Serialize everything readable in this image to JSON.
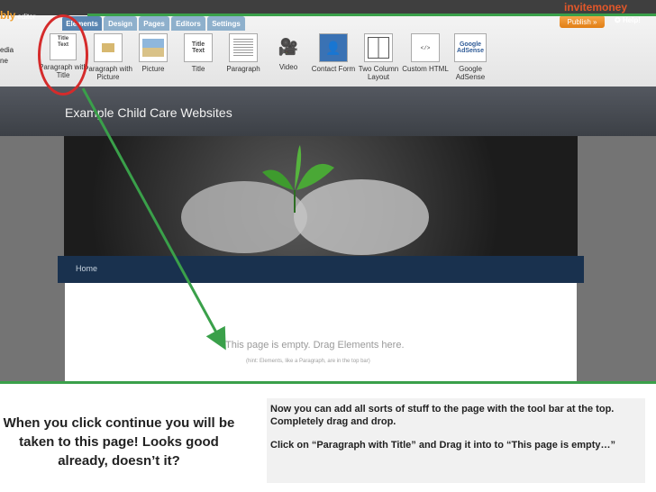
{
  "editor": {
    "logo_text": "bly",
    "logo_suffix": "editor",
    "tabs": [
      "Elements",
      "Design",
      "Pages",
      "Editors",
      "Settings"
    ],
    "active_tab": "Elements",
    "brand": "invitemoney",
    "publish_label": "Publish »",
    "help_label": "Help!",
    "side_labels": [
      "edia",
      "ne"
    ]
  },
  "toolbar": {
    "items": [
      {
        "label": "Paragraph with Title",
        "icon": "paragraph-with-title-icon",
        "preview": "Title Text"
      },
      {
        "label": "Paragraph with Picture",
        "icon": "paragraph-with-picture-icon"
      },
      {
        "label": "Picture",
        "icon": "picture-icon"
      },
      {
        "label": "Title",
        "icon": "title-icon",
        "preview": "Title Text"
      },
      {
        "label": "Paragraph",
        "icon": "paragraph-icon"
      },
      {
        "label": "Video",
        "icon": "video-icon"
      },
      {
        "label": "Contact Form",
        "icon": "contact-form-icon"
      },
      {
        "label": "Two Column Layout",
        "icon": "two-column-icon"
      },
      {
        "label": "Custom HTML",
        "icon": "custom-html-icon"
      },
      {
        "label": "Google AdSense",
        "icon": "google-adsense-icon",
        "preview": "Google AdSense"
      }
    ]
  },
  "site": {
    "title": "Example Child Care Websites",
    "nav_home": "Home",
    "empty_message": "This page is empty. Drag Elements here.",
    "empty_hint": "(hint: Elements, like a Paragraph, are in the top bar)"
  },
  "caption": {
    "left": "When you click continue you will be taken to this page!  Looks good already, doesn’t it?",
    "right_p1": "Now you can add all sorts of stuff to the page with the tool bar at the top.  Completely drag and drop.",
    "right_p2": "Click on “Paragraph with Title” and Drag it into to “This page is empty…”"
  },
  "colors": {
    "highlight_green": "#3aa04a",
    "circle_red": "#d52b2b",
    "nav_blue": "#19314e"
  }
}
